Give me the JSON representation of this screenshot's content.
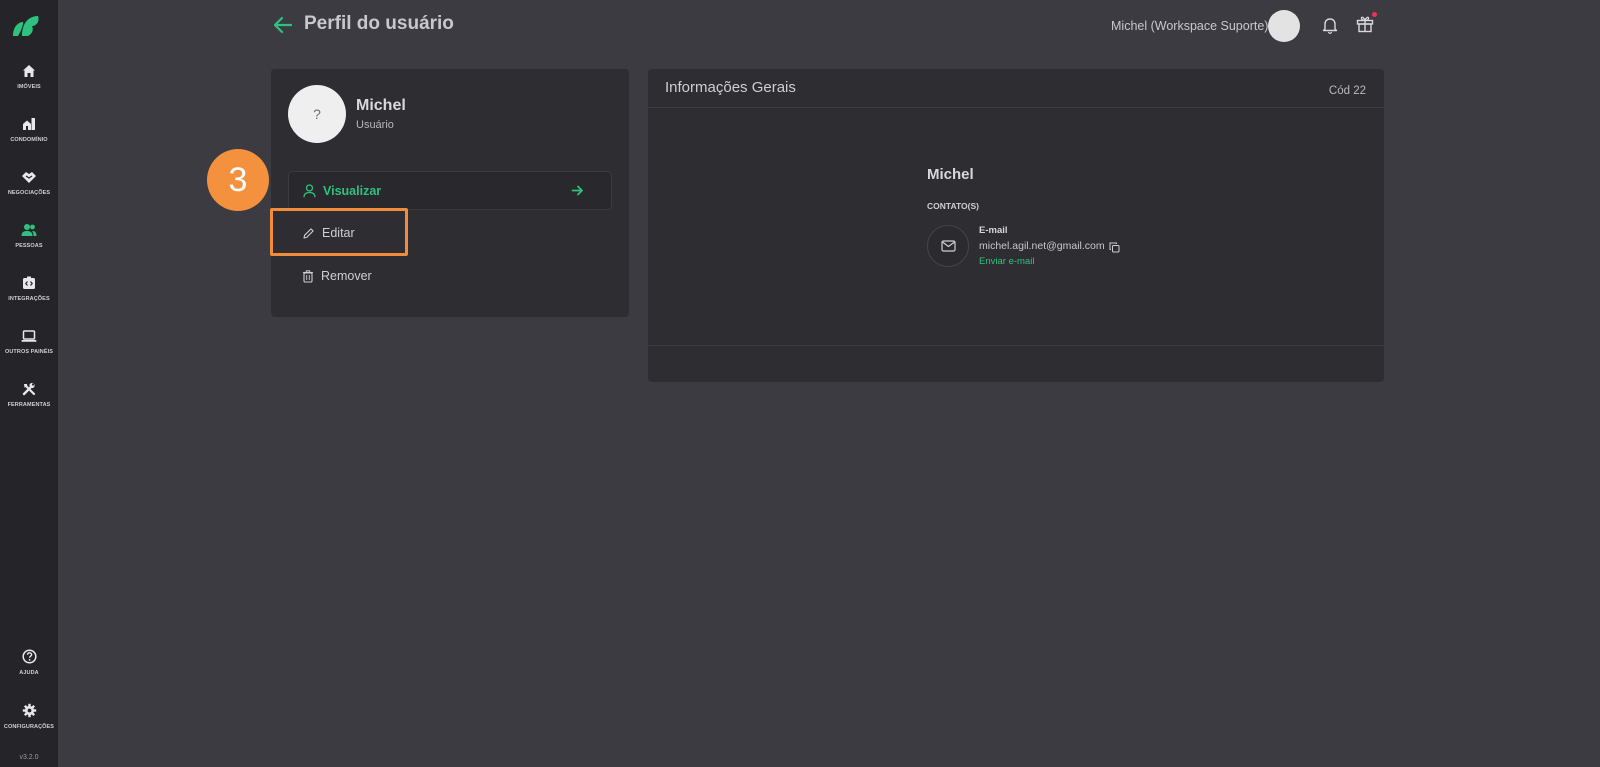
{
  "sidebar": {
    "items": [
      {
        "label": "IMÓVEIS",
        "icon": "home-icon"
      },
      {
        "label": "CONDOMÍNIO",
        "icon": "building-icon"
      },
      {
        "label": "NEGOCIAÇÕES",
        "icon": "handshake-icon"
      },
      {
        "label": "PESSOAS",
        "icon": "people-icon"
      },
      {
        "label": "INTEGRAÇÕES",
        "icon": "integration-icon"
      },
      {
        "label": "OUTROS PAINÉIS",
        "icon": "laptop-icon"
      },
      {
        "label": "FERRAMENTAS",
        "icon": "tools-icon"
      }
    ],
    "bottom": [
      {
        "label": "AJUDA",
        "icon": "help-icon"
      },
      {
        "label": "CONFIGURAÇÕES",
        "icon": "gear-icon"
      }
    ],
    "version": "v3.2.0"
  },
  "header": {
    "title": "Perfil do usuário",
    "user_label": "Michel (Workspace Suporte)"
  },
  "profile": {
    "avatar_placeholder": "?",
    "name": "Michel",
    "role": "Usuário",
    "menu": {
      "view": "Visualizar",
      "edit": "Editar",
      "remove": "Remover"
    }
  },
  "annotation": {
    "step": "3"
  },
  "info": {
    "title": "Informações Gerais",
    "code": "Cód 22",
    "name": "Michel",
    "contacts_heading": "CONTATO(S)",
    "email_type": "E-mail",
    "email": "michel.agil.net@gmail.com",
    "send_email": "Enviar e-mail"
  },
  "colors": {
    "accent": "#2ec27e",
    "highlight": "#f28c3c",
    "background": "#3c3b41",
    "sidebar": "#252529",
    "card": "#2e2d32"
  }
}
